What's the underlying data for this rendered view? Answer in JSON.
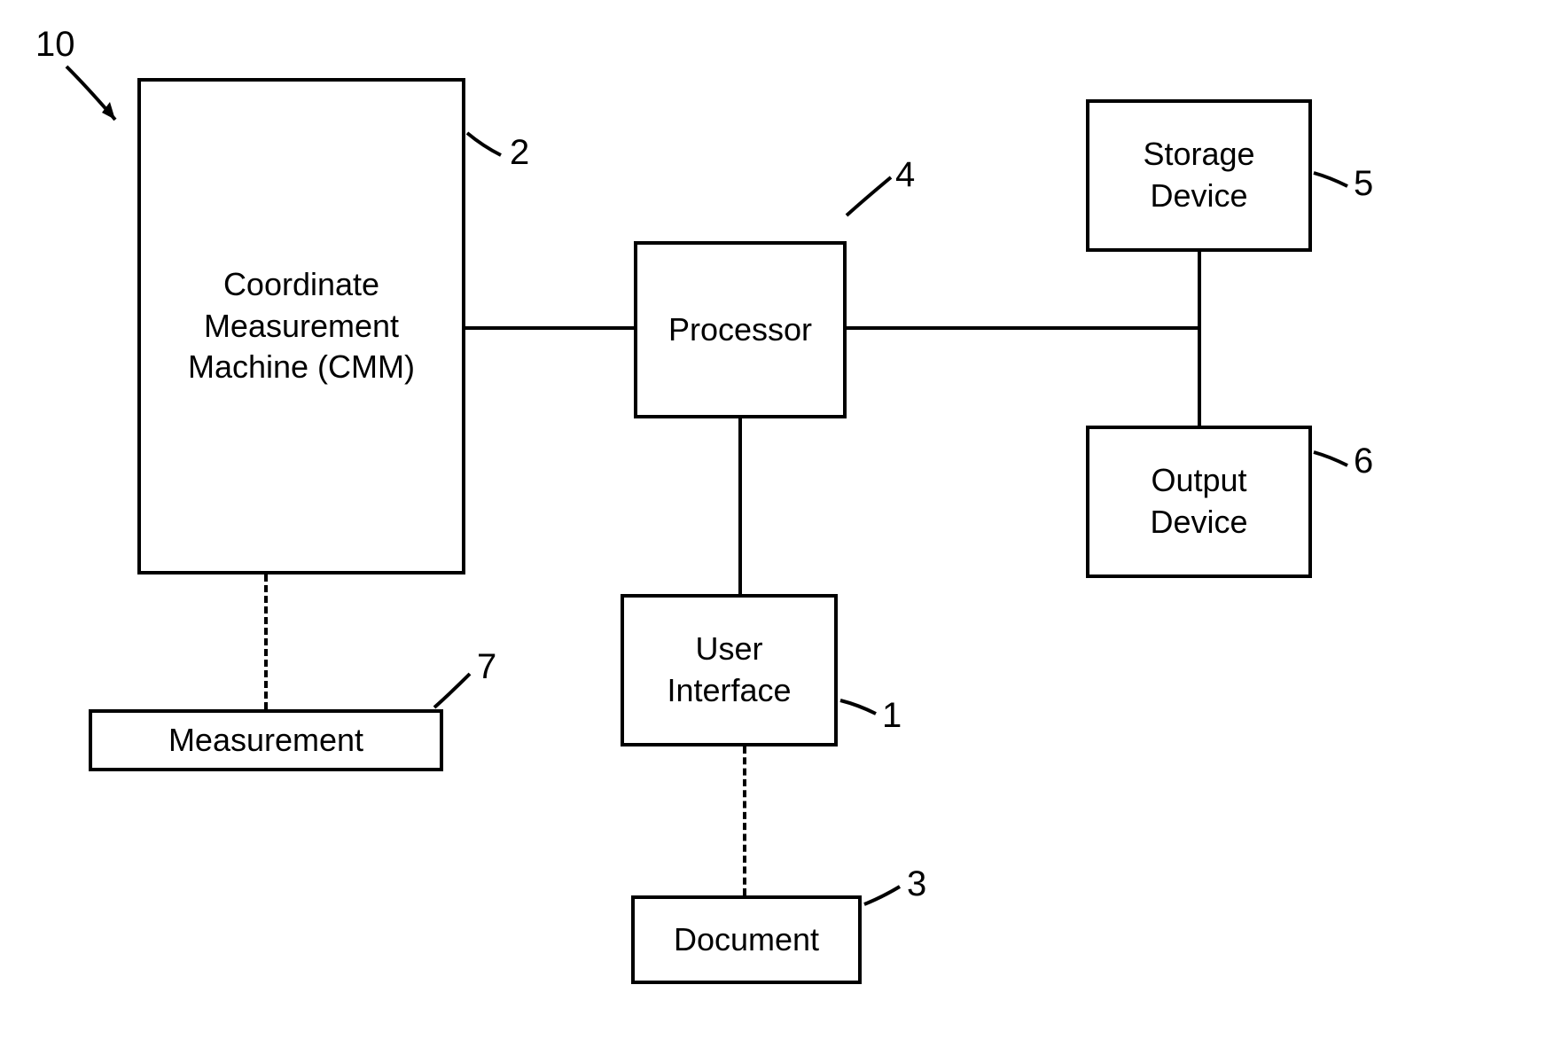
{
  "diagram": {
    "system_ref": "10",
    "blocks": {
      "cmm": {
        "text": "Coordinate\nMeasurement\nMachine (CMM)",
        "ref": "2"
      },
      "processor": {
        "text": "Processor",
        "ref": "4"
      },
      "storage": {
        "text": "Storage\nDevice",
        "ref": "5"
      },
      "output": {
        "text": "Output\nDevice",
        "ref": "6"
      },
      "ui": {
        "text": "User\nInterface",
        "ref": "1"
      },
      "document": {
        "text": "Document",
        "ref": "3"
      },
      "measurement": {
        "text": "Measurement",
        "ref": "7"
      }
    }
  }
}
